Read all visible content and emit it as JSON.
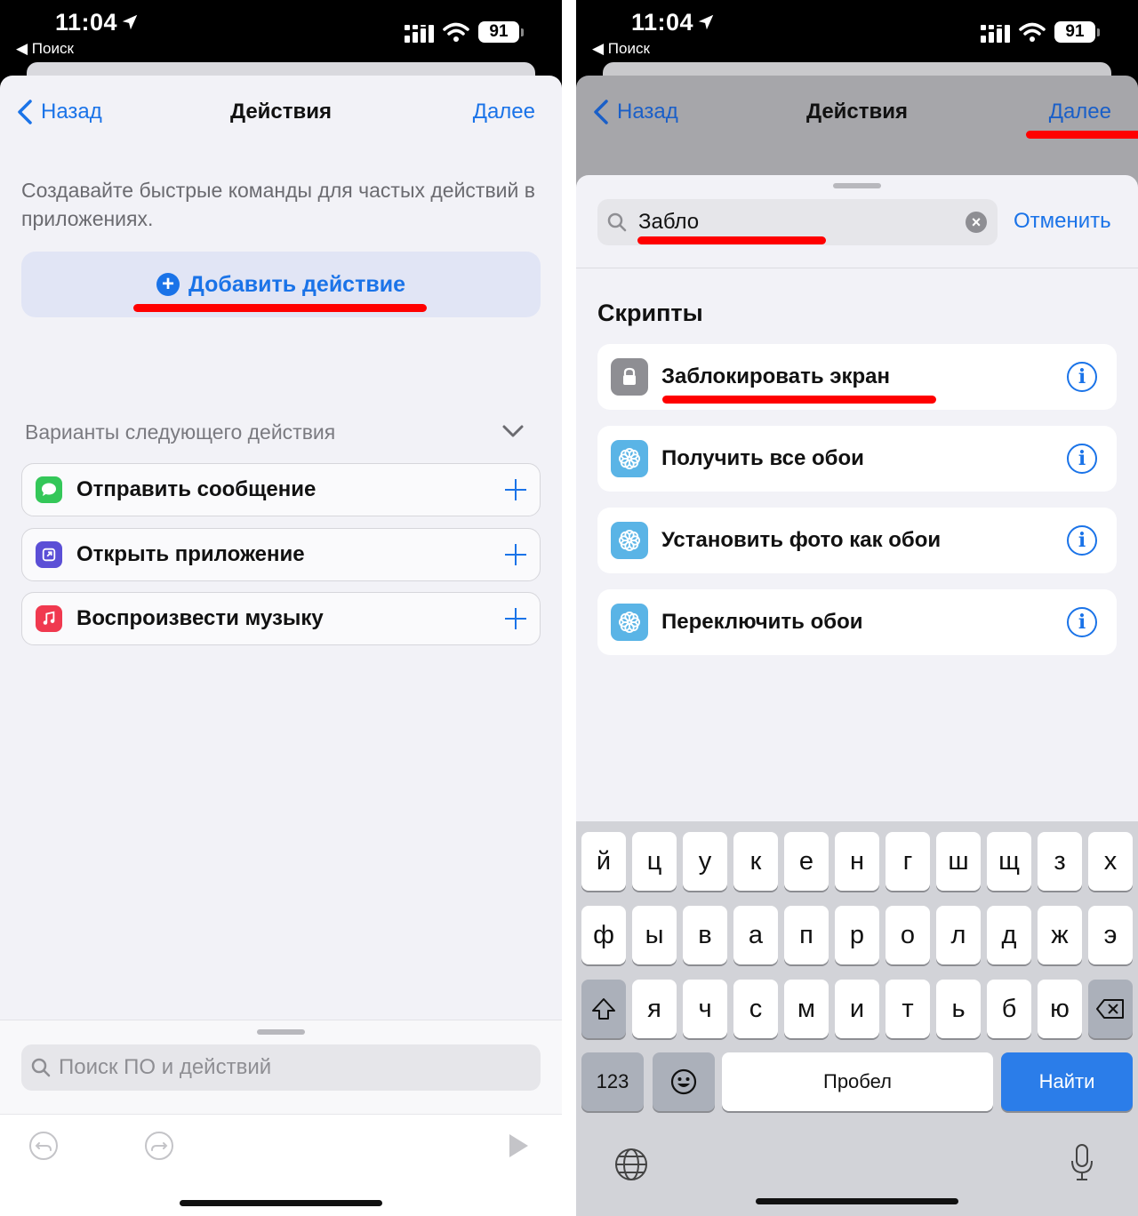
{
  "left": {
    "status": {
      "time": "11:04",
      "back_app": "◀ Поиск",
      "battery": "91"
    },
    "nav": {
      "back": "Назад",
      "title": "Действия",
      "next": "Далее"
    },
    "intro": "Создавайте быстрые команды для частых действий в приложениях.",
    "add_action": "Добавить действие",
    "next_variants": "Варианты следующего действия",
    "suggestions": [
      {
        "label": "Отправить сообщение",
        "icon": "messages-icon",
        "color": "#34c759"
      },
      {
        "label": "Открыть приложение",
        "icon": "open-app-icon",
        "color": "#5b4fd6"
      },
      {
        "label": "Воспроизвести музыку",
        "icon": "music-icon",
        "color": "#f0394f"
      }
    ],
    "search_placeholder": "Поиск ПО и действий"
  },
  "right": {
    "status": {
      "time": "11:04",
      "back_app": "◀ Поиск",
      "battery": "91"
    },
    "nav": {
      "back": "Назад",
      "title": "Действия",
      "next": "Далее"
    },
    "search_query": "Забло",
    "cancel": "Отменить",
    "section": "Скрипты",
    "results": [
      {
        "label": "Заблокировать экран",
        "icon": "lock-icon",
        "color": "#8e8e93"
      },
      {
        "label": "Получить все обои",
        "icon": "wallpaper-icon",
        "color": "#5ab4e6"
      },
      {
        "label": "Установить фото как обои",
        "icon": "wallpaper-icon",
        "color": "#5ab4e6"
      },
      {
        "label": "Переключить обои",
        "icon": "wallpaper-icon",
        "color": "#5ab4e6"
      }
    ],
    "keyboard": {
      "row1": [
        "й",
        "ц",
        "у",
        "к",
        "е",
        "н",
        "г",
        "ш",
        "щ",
        "з",
        "х"
      ],
      "row2": [
        "ф",
        "ы",
        "в",
        "а",
        "п",
        "р",
        "о",
        "л",
        "д",
        "ж",
        "э"
      ],
      "row3": [
        "я",
        "ч",
        "с",
        "м",
        "и",
        "т",
        "ь",
        "б",
        "ю"
      ],
      "numbers": "123",
      "space": "Пробел",
      "go": "Найти"
    }
  },
  "colors": {
    "accent": "#1a73e8",
    "highlight": "#ff0000"
  }
}
